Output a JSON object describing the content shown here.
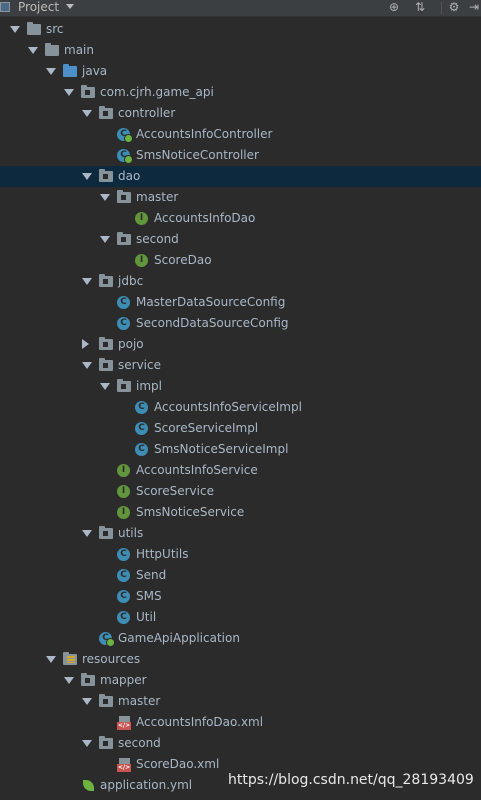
{
  "header": {
    "title": "Project"
  },
  "tree": [
    {
      "label": "src",
      "indent": 0,
      "expanded": true,
      "icon": "folder-gray"
    },
    {
      "label": "main",
      "indent": 1,
      "expanded": true,
      "icon": "folder-gray"
    },
    {
      "label": "java",
      "indent": 2,
      "expanded": true,
      "icon": "folder-blue"
    },
    {
      "label": "com.cjrh.game_api",
      "indent": 3,
      "expanded": true,
      "icon": "package"
    },
    {
      "label": "controller",
      "indent": 4,
      "expanded": true,
      "icon": "package"
    },
    {
      "label": "AccountsInfoController",
      "indent": 5,
      "icon": "class-spring"
    },
    {
      "label": "SmsNoticeController",
      "indent": 5,
      "icon": "class-spring"
    },
    {
      "label": "dao",
      "indent": 4,
      "expanded": true,
      "icon": "package",
      "selected": true
    },
    {
      "label": "master",
      "indent": 5,
      "expanded": true,
      "icon": "package"
    },
    {
      "label": "AccountsInfoDao",
      "indent": 6,
      "icon": "interface"
    },
    {
      "label": "second",
      "indent": 5,
      "expanded": true,
      "icon": "package"
    },
    {
      "label": "ScoreDao",
      "indent": 6,
      "icon": "interface"
    },
    {
      "label": "jdbc",
      "indent": 4,
      "expanded": true,
      "icon": "package"
    },
    {
      "label": "MasterDataSourceConfig",
      "indent": 5,
      "icon": "class"
    },
    {
      "label": "SecondDataSourceConfig",
      "indent": 5,
      "icon": "class"
    },
    {
      "label": "pojo",
      "indent": 4,
      "expanded": false,
      "icon": "package"
    },
    {
      "label": "service",
      "indent": 4,
      "expanded": true,
      "icon": "package"
    },
    {
      "label": "impl",
      "indent": 5,
      "expanded": true,
      "icon": "package"
    },
    {
      "label": "AccountsInfoServiceImpl",
      "indent": 6,
      "icon": "class"
    },
    {
      "label": "ScoreServiceImpl",
      "indent": 6,
      "icon": "class"
    },
    {
      "label": "SmsNoticeServiceImpl",
      "indent": 6,
      "icon": "class"
    },
    {
      "label": "AccountsInfoService",
      "indent": 5,
      "icon": "interface"
    },
    {
      "label": "ScoreService",
      "indent": 5,
      "icon": "interface"
    },
    {
      "label": "SmsNoticeService",
      "indent": 5,
      "icon": "interface"
    },
    {
      "label": "utils",
      "indent": 4,
      "expanded": true,
      "icon": "package"
    },
    {
      "label": "HttpUtils",
      "indent": 5,
      "icon": "class"
    },
    {
      "label": "Send",
      "indent": 5,
      "icon": "class"
    },
    {
      "label": "SMS",
      "indent": 5,
      "icon": "class"
    },
    {
      "label": "Util",
      "indent": 5,
      "icon": "class"
    },
    {
      "label": "GameApiApplication",
      "indent": 4,
      "icon": "class-spring"
    },
    {
      "label": "resources",
      "indent": 2,
      "expanded": true,
      "icon": "folder-resources"
    },
    {
      "label": "mapper",
      "indent": 3,
      "expanded": true,
      "icon": "package"
    },
    {
      "label": "master",
      "indent": 4,
      "expanded": true,
      "icon": "package"
    },
    {
      "label": "AccountsInfoDao.xml",
      "indent": 5,
      "icon": "xml"
    },
    {
      "label": "second",
      "indent": 4,
      "expanded": true,
      "icon": "package"
    },
    {
      "label": "ScoreDao.xml",
      "indent": 5,
      "icon": "xml"
    },
    {
      "label": "application.yml",
      "indent": 3,
      "icon": "yml"
    }
  ],
  "watermark": "https://blog.csdn.net/qq_28193409"
}
